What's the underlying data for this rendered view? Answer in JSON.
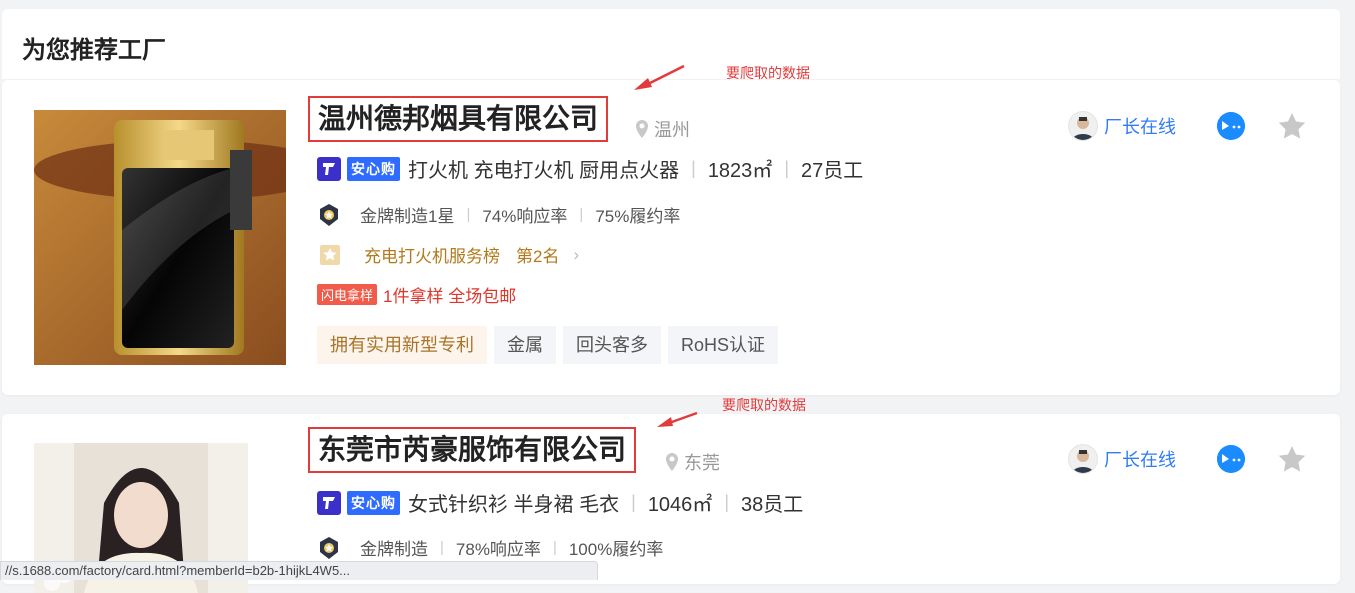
{
  "section_title": "为您推荐工厂",
  "annotation_label": "要爬取的数据",
  "factories": [
    {
      "name": "温州德邦烟具有限公司",
      "location": "温州",
      "badge": "安心购",
      "categories": "打火机 充电打火机 厨用点火器",
      "area": "1823㎡",
      "employees": "27员工",
      "rating": "金牌制造1星",
      "response_rate": "74%响应率",
      "fulfillment_rate": "75%履约率",
      "rank_list": "充电打火机服务榜",
      "rank_position": "第2名",
      "promo_tag": "闪电拿样",
      "promo_text": "1件拿样 全场包邮",
      "tags": [
        "拥有实用新型专利",
        "金属",
        "回头客多",
        "RoHS认证"
      ],
      "online_label": "厂长在线"
    },
    {
      "name": "东莞市芮豪服饰有限公司",
      "location": "东莞",
      "badge": "安心购",
      "categories": "女式针织衫 半身裙 毛衣",
      "area": "1046㎡",
      "employees": "38员工",
      "rating": "金牌制造",
      "response_rate": "78%响应率",
      "fulfillment_rate": "100%履约率",
      "online_label": "厂长在线"
    }
  ],
  "status_url": "//s.1688.com/factory/card.html?memberId=b2b-1hijkL4W5..."
}
